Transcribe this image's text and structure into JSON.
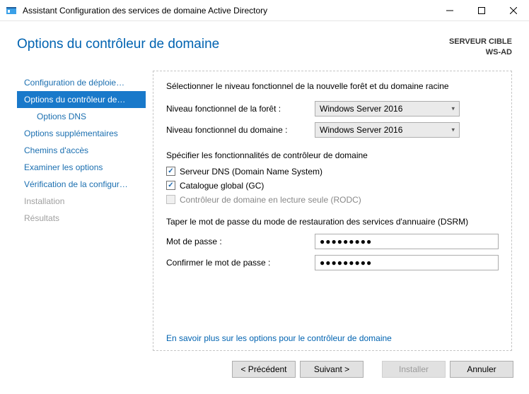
{
  "titlebar": {
    "title": "Assistant Configuration des services de domaine Active Directory"
  },
  "header": {
    "page_title": "Options du contrôleur de domaine",
    "target_label": "SERVEUR CIBLE",
    "target_value": "WS-AD"
  },
  "sidebar": {
    "items": [
      {
        "label": "Configuration de déploie…",
        "active": false,
        "sub": false,
        "disabled": false
      },
      {
        "label": "Options du contrôleur de…",
        "active": true,
        "sub": false,
        "disabled": false
      },
      {
        "label": "Options DNS",
        "active": false,
        "sub": true,
        "disabled": false
      },
      {
        "label": "Options supplémentaires",
        "active": false,
        "sub": false,
        "disabled": false
      },
      {
        "label": "Chemins d'accès",
        "active": false,
        "sub": false,
        "disabled": false
      },
      {
        "label": "Examiner les options",
        "active": false,
        "sub": false,
        "disabled": false
      },
      {
        "label": "Vérification de la configur…",
        "active": false,
        "sub": false,
        "disabled": false
      },
      {
        "label": "Installation",
        "active": false,
        "sub": false,
        "disabled": true
      },
      {
        "label": "Résultats",
        "active": false,
        "sub": false,
        "disabled": true
      }
    ]
  },
  "content": {
    "intro": "Sélectionner le niveau fonctionnel de la nouvelle forêt et du domaine racine",
    "forest_label": "Niveau fonctionnel de la forêt :",
    "forest_value": "Windows Server 2016",
    "domain_label": "Niveau fonctionnel du domaine :",
    "domain_value": "Windows Server 2016",
    "caps_label": "Spécifier les fonctionnalités de contrôleur de domaine",
    "check_dns": "Serveur DNS (Domain Name System)",
    "check_gc": "Catalogue global (GC)",
    "check_rodc": "Contrôleur de domaine en lecture seule (RODC)",
    "dsrm_label": "Taper le mot de passe du mode de restauration des services d'annuaire (DSRM)",
    "pw_label": "Mot de passe :",
    "pw_value": "●●●●●●●●●",
    "pwc_label": "Confirmer le mot de passe :",
    "pwc_value": "●●●●●●●●●",
    "learn_more": "En savoir plus sur les options pour le contrôleur de domaine"
  },
  "footer": {
    "prev": "< Précédent",
    "next": "Suivant >",
    "install": "Installer",
    "cancel": "Annuler"
  }
}
